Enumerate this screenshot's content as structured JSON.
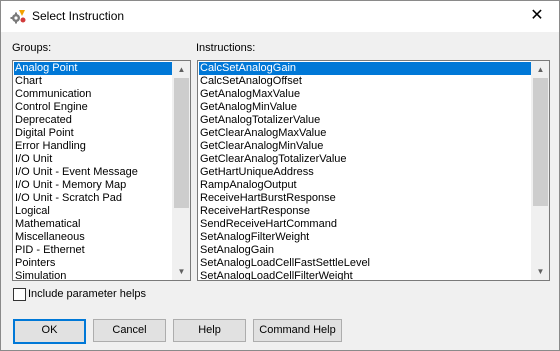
{
  "window": {
    "title": "Select Instruction",
    "close_glyph": "✕"
  },
  "groups": {
    "label": "Groups:",
    "items": [
      "Analog Point",
      "Chart",
      "Communication",
      "Control Engine",
      "Deprecated",
      "Digital Point",
      "Error Handling",
      "I/O Unit",
      "I/O Unit - Event Message",
      "I/O Unit - Memory Map",
      "I/O Unit - Scratch Pad",
      "Logical",
      "Mathematical",
      "Miscellaneous",
      "PID - Ethernet",
      "Pointers",
      "Simulation"
    ],
    "selected": "Analog Point"
  },
  "instructions": {
    "label": "Instructions:",
    "items": [
      "CalcSetAnalogGain",
      "CalcSetAnalogOffset",
      "GetAnalogMaxValue",
      "GetAnalogMinValue",
      "GetAnalogTotalizerValue",
      "GetClearAnalogMaxValue",
      "GetClearAnalogMinValue",
      "GetClearAnalogTotalizerValue",
      "GetHartUniqueAddress",
      "RampAnalogOutput",
      "ReceiveHartBurstResponse",
      "ReceiveHartResponse",
      "SendReceiveHartCommand",
      "SetAnalogFilterWeight",
      "SetAnalogGain",
      "SetAnalogLoadCellFastSettleLevel",
      "SetAnalogLoadCellFilterWeight"
    ],
    "selected": "CalcSetAnalogGain"
  },
  "scroll_arrows": {
    "up": "▲",
    "down": "▼"
  },
  "options": {
    "include_param_helps_label": "Include parameter helps",
    "include_param_helps_checked": false
  },
  "buttons": {
    "ok": "OK",
    "cancel": "Cancel",
    "help": "Help",
    "command_help": "Command Help"
  },
  "colors": {
    "selection": "#0078d7",
    "default_button_border": "#0078d7"
  }
}
